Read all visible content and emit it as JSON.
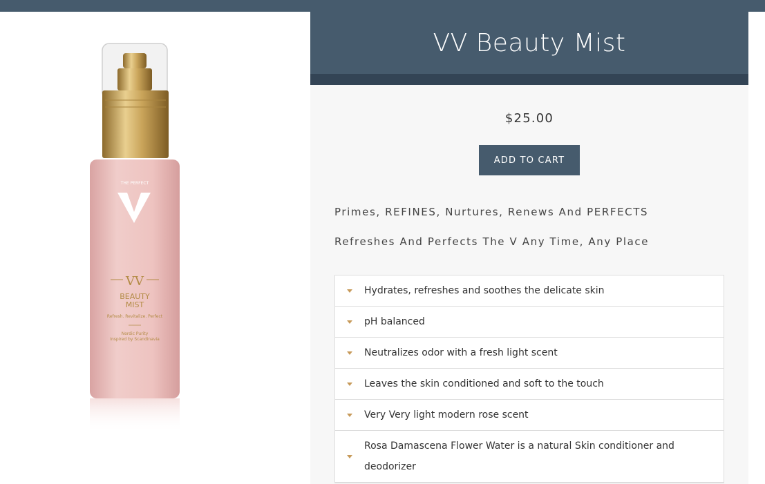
{
  "product": {
    "title": "VV Beauty Mist",
    "price": "$25.00",
    "add_to_cart_label": "ADD TO CART",
    "taglines": [
      "Primes, REFINES, Nurtures, Renews And PERFECTS",
      "Refreshes And Perfects The V Any Time, Any Place"
    ],
    "features": [
      "Hydrates, refreshes and soothes the delicate skin",
      "pH balanced",
      "Neutralizes odor with a fresh light scent",
      "Leaves the skin conditioned and soft to the touch",
      "Very Very light modern rose scent",
      "Rosa Damascena Flower Water is a natural Skin conditioner and deodorizer"
    ]
  },
  "bottle_label": {
    "brand_small": "THE PERFECT",
    "monogram": "V",
    "series": "VV",
    "name_line1": "BEAUTY",
    "name_line2": "MIST",
    "claim": "Refresh. Revitalize. Perfect",
    "origin_line1": "Nordic Purity",
    "origin_line2": "Inspired by Scandinavia"
  },
  "colors": {
    "header_bg": "#465b6d",
    "accent_gold": "#c79a5a",
    "bottle_pink": "#e8b9b8"
  },
  "icons": {
    "feature_caret": "caret-down-icon"
  }
}
